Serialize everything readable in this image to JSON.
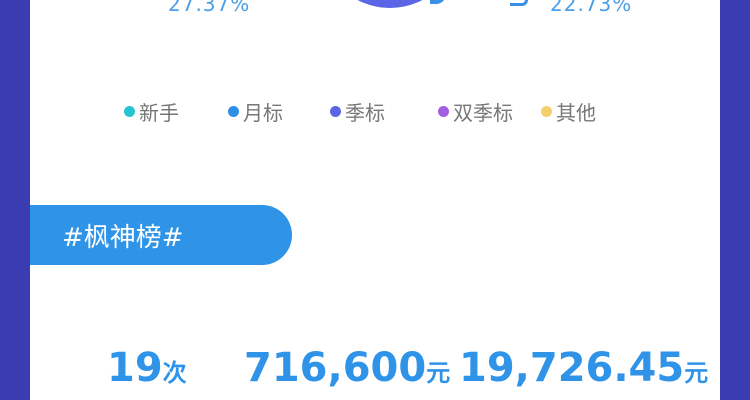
{
  "donut": {
    "pct_left": "27.37%",
    "pct_right": "22.73%",
    "colors": {
      "main": "#5a66e6",
      "accent": "#3a8fe6"
    }
  },
  "legend": [
    {
      "label": "新手",
      "color": "#27c4d4"
    },
    {
      "label": "月标",
      "color": "#2f8fe6"
    },
    {
      "label": "季标",
      "color": "#5a66e6"
    },
    {
      "label": "双季标",
      "color": "#a35de3"
    },
    {
      "label": "其他",
      "color": "#f5cf6b"
    }
  ],
  "banner": {
    "title": "#枫神榜#"
  },
  "stats": [
    {
      "value": "19",
      "unit": "次"
    },
    {
      "value": "716,600",
      "unit": "元"
    },
    {
      "value": "19,726.45",
      "unit": "元"
    }
  ],
  "colors": {
    "background": "#3a3db2",
    "card": "#ffffff",
    "accent": "#2f93e8"
  }
}
